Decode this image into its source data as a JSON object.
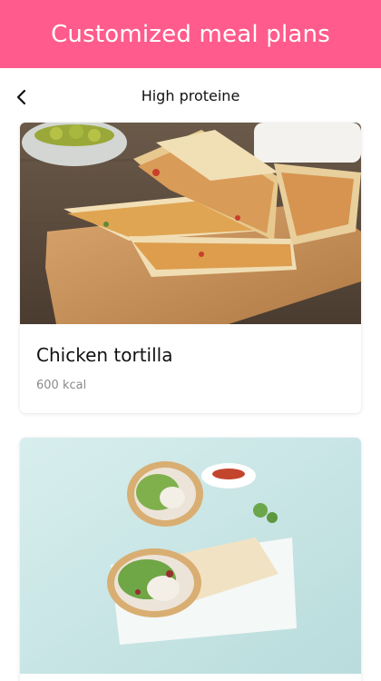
{
  "banner": {
    "title": "Customized meal plans"
  },
  "header": {
    "title": "High proteine",
    "back_icon": "chevron-left-icon"
  },
  "meals": [
    {
      "name": "Chicken tortilla",
      "kcal": "600 kcal",
      "image": "quesadilla-photo"
    },
    {
      "name": "",
      "kcal": "",
      "image": "chicken-wrap-photo"
    }
  ],
  "colors": {
    "banner": "#ff5b8c",
    "text": "#111111",
    "muted": "#8a8a8a"
  }
}
